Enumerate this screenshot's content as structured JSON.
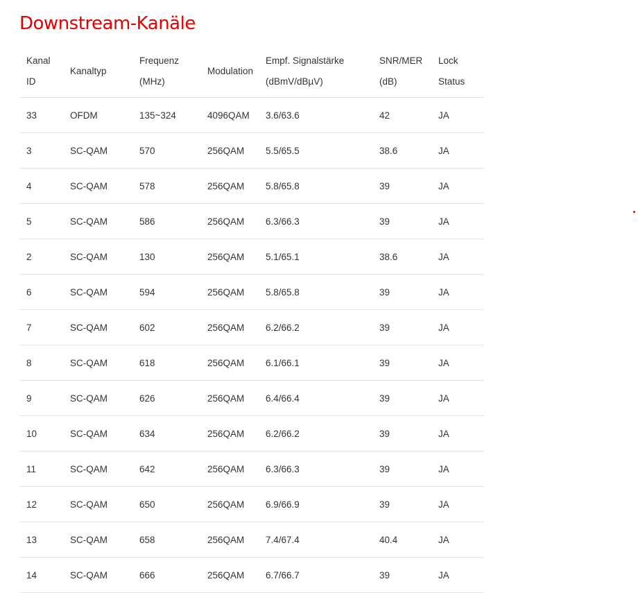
{
  "page": {
    "title": "Downstream-Kanäle"
  },
  "table": {
    "headers": [
      {
        "line1": "Kanal",
        "line2": "ID"
      },
      {
        "line1": "Kanaltyp",
        "line2": ""
      },
      {
        "line1": "Frequenz",
        "line2": "(MHz)"
      },
      {
        "line1": "Modulation",
        "line2": ""
      },
      {
        "line1": "Empf. Signalstärke",
        "line2": "(dBmV/dBµV)"
      },
      {
        "line1": "SNR/MER",
        "line2": "(dB)"
      },
      {
        "line1": "Lock",
        "line2": "Status"
      }
    ],
    "rows": [
      [
        "33",
        "OFDM",
        "135~324",
        "4096QAM",
        "3.6/63.6",
        "42",
        "JA"
      ],
      [
        "3",
        "SC-QAM",
        "570",
        "256QAM",
        "5.5/65.5",
        "38.6",
        "JA"
      ],
      [
        "4",
        "SC-QAM",
        "578",
        "256QAM",
        "5.8/65.8",
        "39",
        "JA"
      ],
      [
        "5",
        "SC-QAM",
        "586",
        "256QAM",
        "6.3/66.3",
        "39",
        "JA"
      ],
      [
        "2",
        "SC-QAM",
        "130",
        "256QAM",
        "5.1/65.1",
        "38.6",
        "JA"
      ],
      [
        "6",
        "SC-QAM",
        "594",
        "256QAM",
        "5.8/65.8",
        "39",
        "JA"
      ],
      [
        "7",
        "SC-QAM",
        "602",
        "256QAM",
        "6.2/66.2",
        "39",
        "JA"
      ],
      [
        "8",
        "SC-QAM",
        "618",
        "256QAM",
        "6.1/66.1",
        "39",
        "JA"
      ],
      [
        "9",
        "SC-QAM",
        "626",
        "256QAM",
        "6.4/66.4",
        "39",
        "JA"
      ],
      [
        "10",
        "SC-QAM",
        "634",
        "256QAM",
        "6.2/66.2",
        "39",
        "JA"
      ],
      [
        "11",
        "SC-QAM",
        "642",
        "256QAM",
        "6.3/66.3",
        "39",
        "JA"
      ],
      [
        "12",
        "SC-QAM",
        "650",
        "256QAM",
        "6.9/66.9",
        "39",
        "JA"
      ],
      [
        "13",
        "SC-QAM",
        "658",
        "256QAM",
        "7.4/67.4",
        "40.4",
        "JA"
      ],
      [
        "14",
        "SC-QAM",
        "666",
        "256QAM",
        "6.7/66.7",
        "39",
        "JA"
      ]
    ]
  },
  "colors": {
    "title": "#e60000",
    "text": "#333333",
    "divider": "#e3e3e3"
  }
}
